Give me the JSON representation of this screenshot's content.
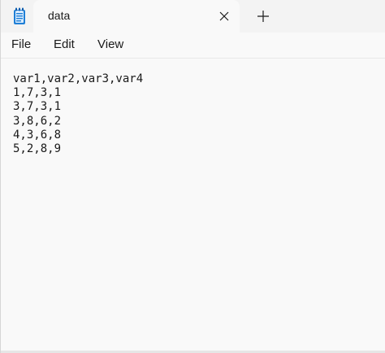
{
  "window": {
    "tab_title": "data"
  },
  "menu": {
    "file": "File",
    "edit": "Edit",
    "view": "View"
  },
  "editor": {
    "lines": [
      "var1,var2,var3,var4",
      "1,7,3,1",
      "3,7,3,1",
      "3,8,6,2",
      "4,3,6,8",
      "5,2,8,9"
    ]
  },
  "icons": {
    "app": "notepad-icon",
    "close": "close-icon",
    "add": "plus-icon"
  },
  "colors": {
    "accent": "#0b5cad",
    "icon_blue": "#1f7fd6",
    "text": "#1a1a1a"
  }
}
